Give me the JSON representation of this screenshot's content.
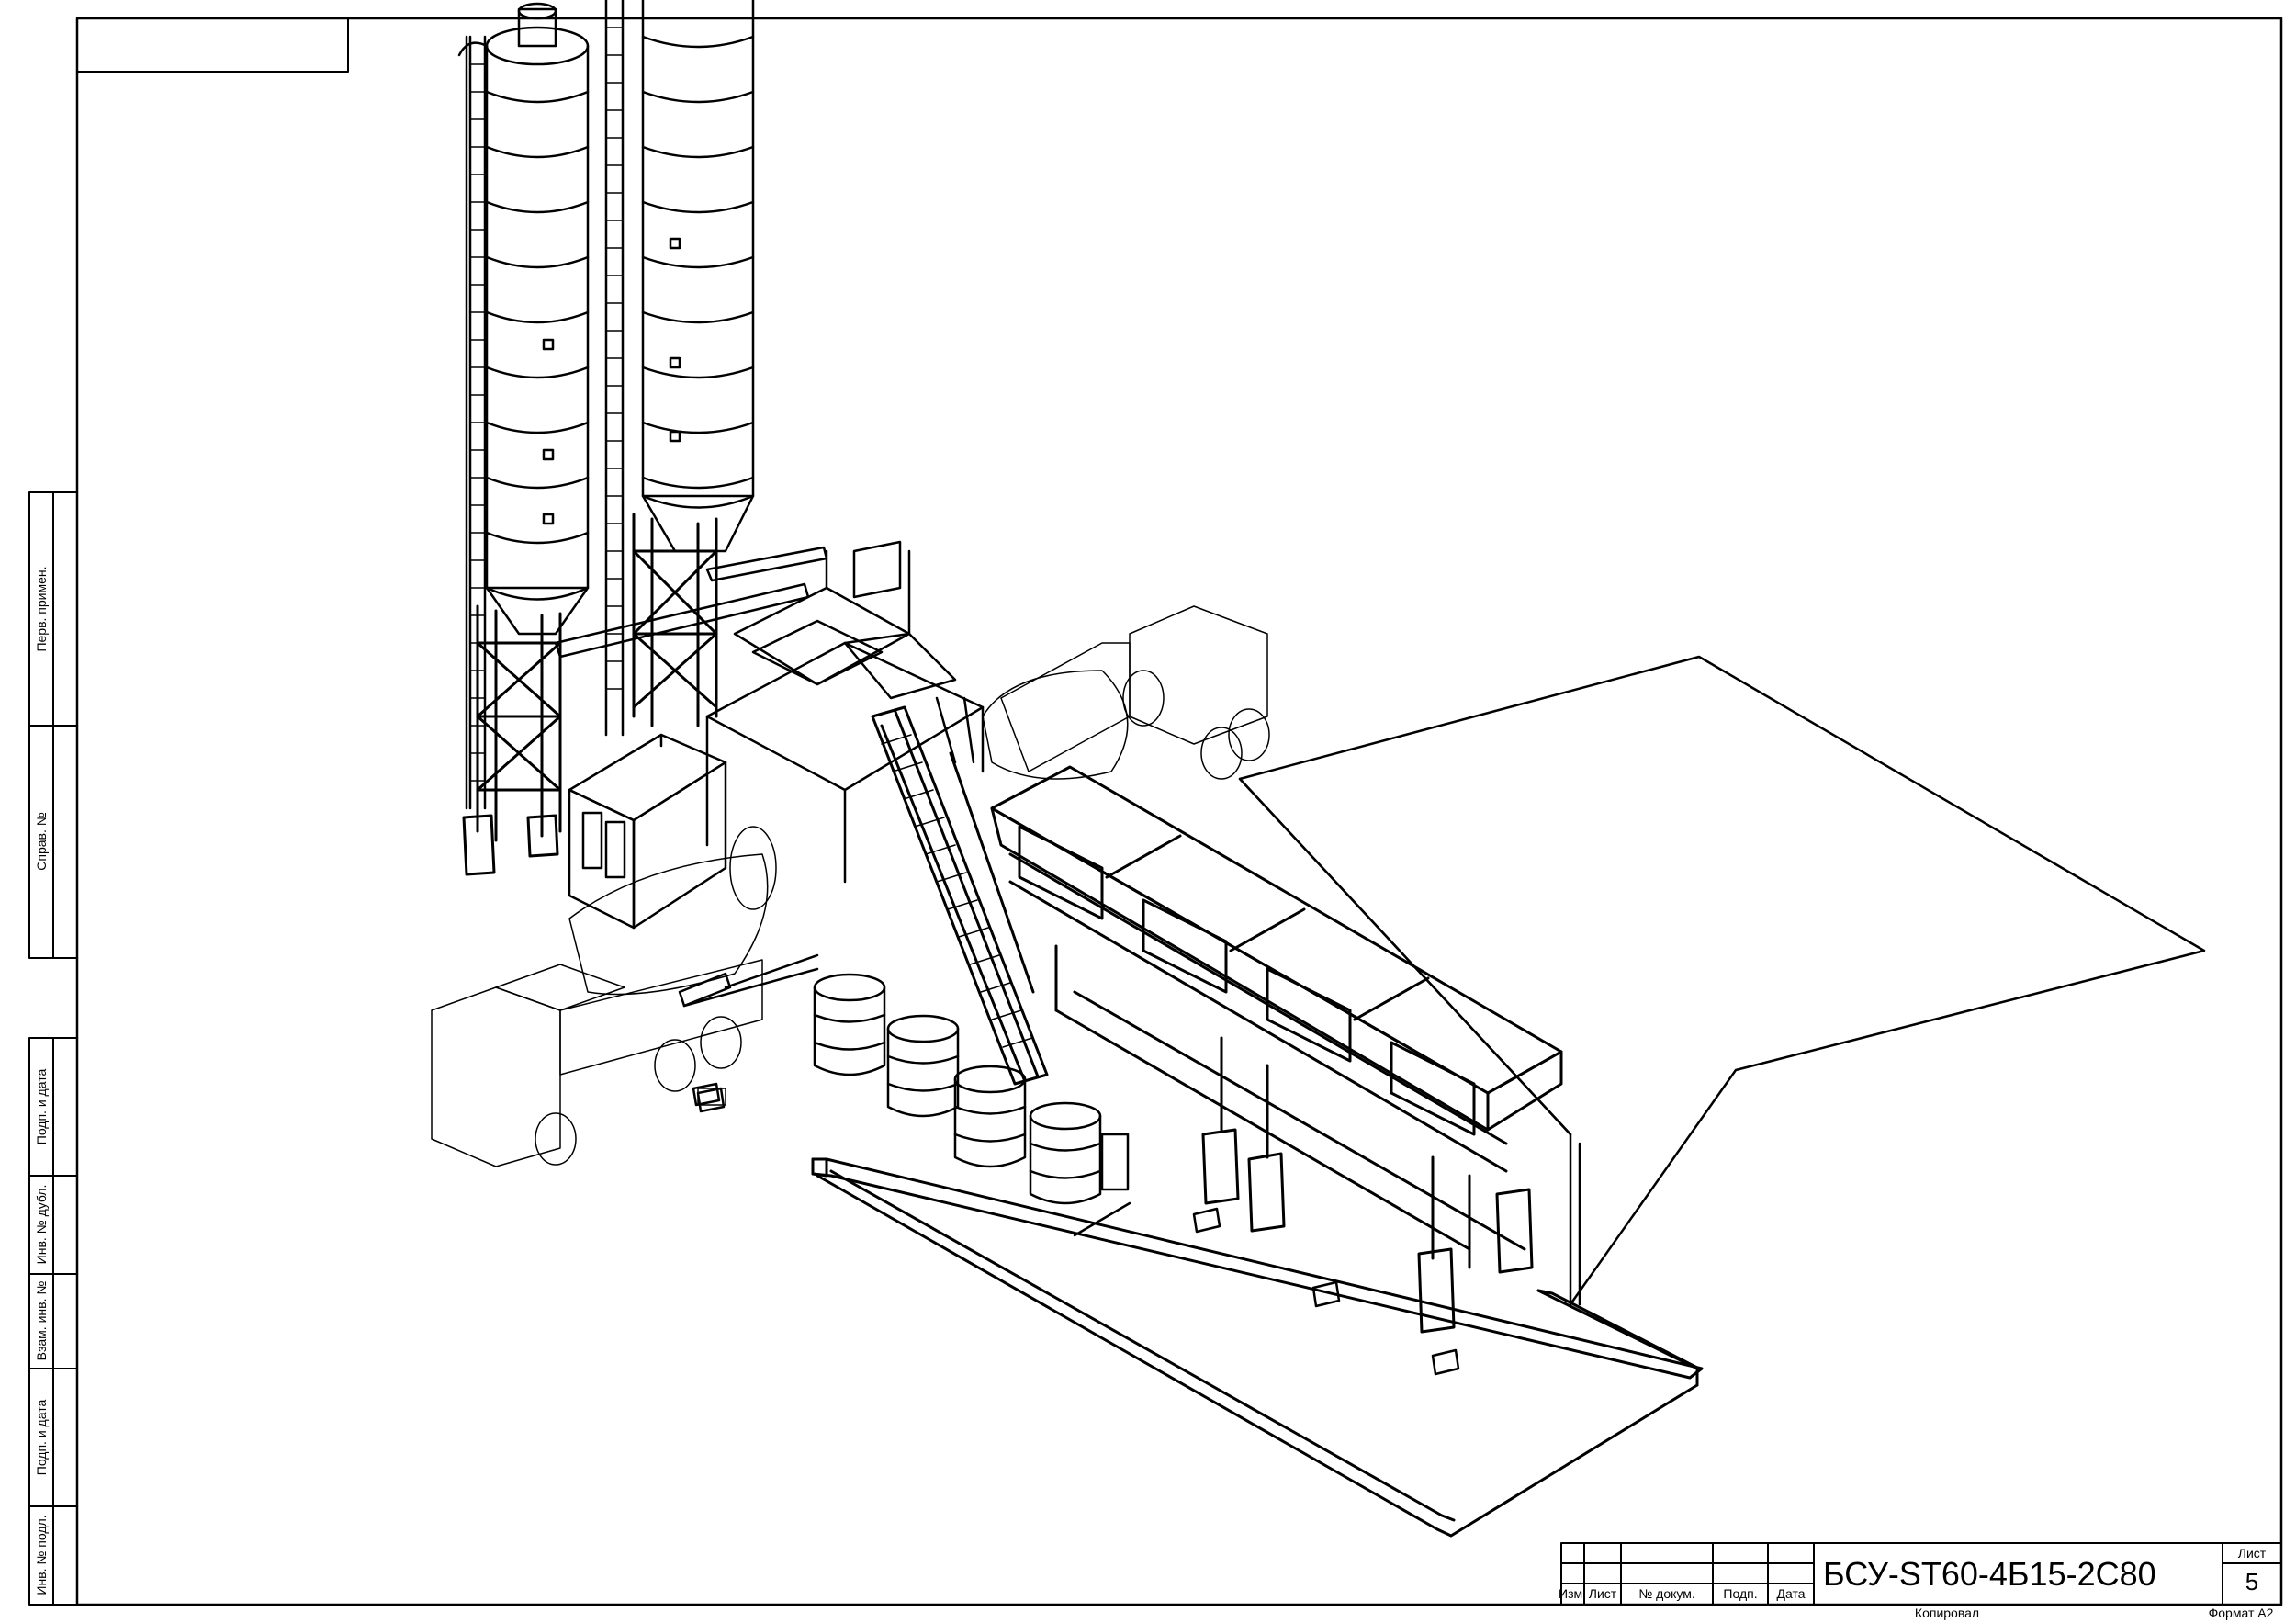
{
  "margin_labels": {
    "perv_primen": "Перв. примен.",
    "sprav_no": "Справ. №",
    "podp_data_1": "Подп. и дата",
    "inv_dubl": "Инв. № дубл.",
    "vzam_inv": "Взам. инв. №",
    "podp_data_2": "Подп. и дата",
    "inv_podl": "Инв. № подл."
  },
  "title_block": {
    "izm": "Изм.",
    "list_col": "Лист",
    "no_dokum": "№ докум.",
    "podp": "Подп.",
    "data": "Дата",
    "designation": "БСУ-ST60-4Б15-2С80",
    "list_label": "Лист",
    "sheet_number": "5",
    "kopiroval": "Копировал",
    "format": "Формат А2"
  }
}
